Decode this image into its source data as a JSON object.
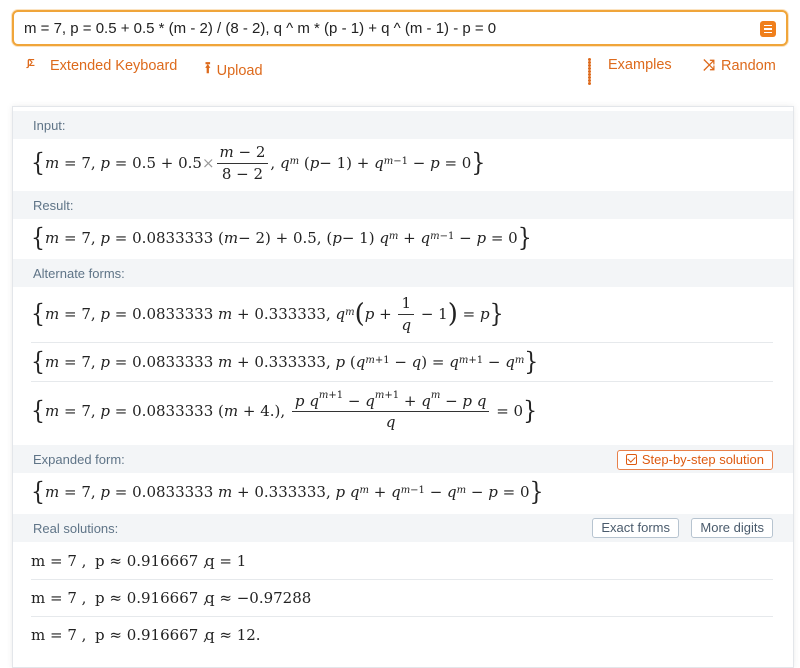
{
  "search": {
    "query": "m = 7, p = 0.5 + 0.5 * (m - 2) / (8 - 2), q ^ m * (p - 1) + q ^ (m - 1) - p = 0"
  },
  "toolbar": {
    "extended_keyboard": "Extended Keyboard",
    "upload": "Upload",
    "examples": "Examples",
    "random": "Random"
  },
  "pods": {
    "input": {
      "title": "Input:"
    },
    "result": {
      "title": "Result:"
    },
    "alternate": {
      "title": "Alternate forms:"
    },
    "expanded": {
      "title": "Expanded form:",
      "step_button": "Step-by-step solution"
    },
    "real_solutions": {
      "title": "Real solutions:",
      "exact_button": "Exact forms",
      "more_digits_button": "More digits",
      "rows": [
        {
          "m": "m = 7 ,",
          "p": "p ≈ 0.916667 ,",
          "q": "q = 1"
        },
        {
          "m": "m = 7 ,",
          "p": "p ≈ 0.916667 ,",
          "q": "q ≈ −0.97288"
        },
        {
          "m": "m = 7 ,",
          "p": "p ≈ 0.916667 ,",
          "q": "q ≈ 12."
        }
      ]
    }
  },
  "colors": {
    "accent": "#dd6a1c",
    "search_border": "#f0a53a",
    "pod_header_bg": "#f3f5f7",
    "pod_header_text": "#5f7487"
  },
  "icons": {
    "keyboard": "extended-keyboard-icon",
    "upload": "upload-arrow-icon",
    "examples": "grid-dots-icon",
    "random": "shuffle-icon",
    "menu": "menu-icon",
    "step": "checkbox-icon"
  }
}
